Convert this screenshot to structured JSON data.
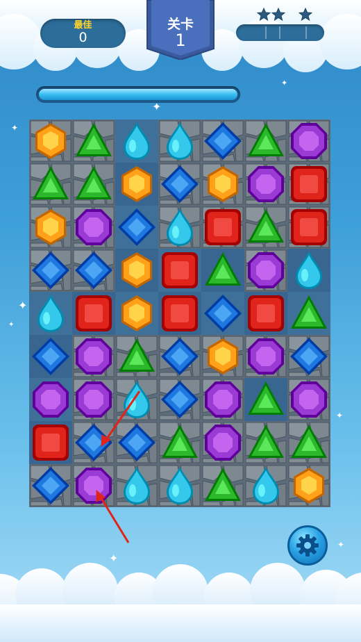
{
  "hud": {
    "best_label": "最佳",
    "best_value": "0",
    "level_label": "关卡",
    "level_value": "1",
    "stars_earned": 0,
    "stars_total": 3,
    "progress_fraction": 1.0
  },
  "board": {
    "rows": 9,
    "cols": 7,
    "stone_cells": [
      [
        1,
        1,
        0,
        1,
        1,
        1,
        1
      ],
      [
        1,
        1,
        0,
        1,
        1,
        1,
        1
      ],
      [
        1,
        1,
        0,
        1,
        1,
        1,
        1
      ],
      [
        1,
        1,
        0,
        0,
        0,
        1,
        0
      ],
      [
        0,
        0,
        0,
        0,
        0,
        0,
        0
      ],
      [
        0,
        1,
        1,
        1,
        1,
        1,
        1
      ],
      [
        0,
        1,
        1,
        1,
        1,
        0,
        1
      ],
      [
        0,
        1,
        1,
        1,
        1,
        1,
        1
      ],
      [
        1,
        1,
        1,
        1,
        1,
        1,
        1
      ]
    ],
    "gems": [
      [
        "orange",
        "green",
        "cyan",
        "cyan",
        "blue",
        "green",
        "purple"
      ],
      [
        "green",
        "green",
        "orange",
        "blue",
        "orange",
        "purple",
        "red"
      ],
      [
        "orange",
        "purple",
        "blue",
        "cyan",
        "red",
        "green",
        "red"
      ],
      [
        "blue",
        "blue",
        "orange",
        "red",
        "green",
        "purple",
        "cyan"
      ],
      [
        "cyan",
        "red",
        "orange",
        "red",
        "blue",
        "red",
        "green"
      ],
      [
        "blue",
        "purple",
        "green",
        "blue",
        "orange",
        "purple",
        "blue"
      ],
      [
        "purple",
        "purple",
        "cyan",
        "blue",
        "purple",
        "green",
        "purple"
      ],
      [
        "red",
        "blue",
        "blue",
        "green",
        "purple",
        "green",
        "green"
      ],
      [
        "blue",
        "purple",
        "cyan",
        "cyan",
        "green",
        "cyan",
        "orange"
      ]
    ]
  },
  "gem_colors": {
    "orange": "#ffa21a",
    "green": "#2bb82b",
    "cyan": "#33c8ec",
    "blue": "#1f78e0",
    "purple": "#9b3bd6",
    "red": "#e0241c"
  },
  "gem_shapes": {
    "orange": "hexagon",
    "green": "triangle",
    "cyan": "droplet",
    "blue": "diamond",
    "purple": "octagon",
    "red": "square-gem"
  },
  "hint": {
    "arrow_color": "#e0241c",
    "from_cell": [
      8,
      1
    ],
    "to_cell": [
      7,
      1
    ]
  },
  "settings": {
    "icon": "gear-icon"
  }
}
